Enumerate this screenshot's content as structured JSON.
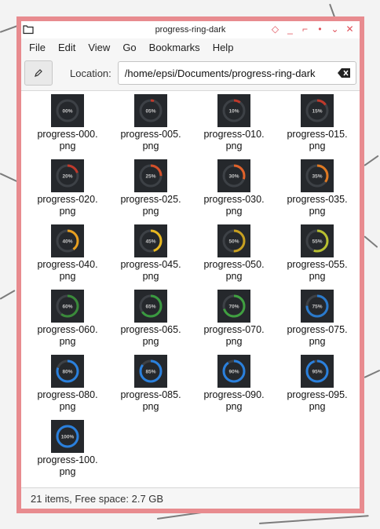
{
  "window": {
    "title": "progress-ring-dark"
  },
  "menu": [
    "File",
    "Edit",
    "View",
    "Go",
    "Bookmarks",
    "Help"
  ],
  "location": {
    "label": "Location:",
    "path": "/home/epsi/Documents/progress-ring-dark"
  },
  "files": [
    {
      "name": "progress-000.png",
      "line1": "progress-000.",
      "line2": "png",
      "percent": 0,
      "label": "00%",
      "color": "#666666"
    },
    {
      "name": "progress-005.png",
      "line1": "progress-005.",
      "line2": "png",
      "percent": 5,
      "label": "05%",
      "color": "#c0392b"
    },
    {
      "name": "progress-010.png",
      "line1": "progress-010.",
      "line2": "png",
      "percent": 10,
      "label": "10%",
      "color": "#c0392b"
    },
    {
      "name": "progress-015.png",
      "line1": "progress-015.",
      "line2": "png",
      "percent": 15,
      "label": "15%",
      "color": "#c0392b"
    },
    {
      "name": "progress-020.png",
      "line1": "progress-020.",
      "line2": "png",
      "percent": 20,
      "label": "20%",
      "color": "#c0392b"
    },
    {
      "name": "progress-025.png",
      "line1": "progress-025.",
      "line2": "png",
      "percent": 25,
      "label": "25%",
      "color": "#d4502a"
    },
    {
      "name": "progress-030.png",
      "line1": "progress-030.",
      "line2": "png",
      "percent": 30,
      "label": "30%",
      "color": "#e0622a"
    },
    {
      "name": "progress-035.png",
      "line1": "progress-035.",
      "line2": "png",
      "percent": 35,
      "label": "35%",
      "color": "#e07a22"
    },
    {
      "name": "progress-040.png",
      "line1": "progress-040.",
      "line2": "png",
      "percent": 40,
      "label": "40%",
      "color": "#e8a020"
    },
    {
      "name": "progress-045.png",
      "line1": "progress-045.",
      "line2": "png",
      "percent": 45,
      "label": "45%",
      "color": "#e8b820"
    },
    {
      "name": "progress-050.png",
      "line1": "progress-050.",
      "line2": "png",
      "percent": 50,
      "label": "50%",
      "color": "#c8a020"
    },
    {
      "name": "progress-055.png",
      "line1": "progress-055.",
      "line2": "png",
      "percent": 55,
      "label": "55%",
      "color": "#b8c030"
    },
    {
      "name": "progress-060.png",
      "line1": "progress-060.",
      "line2": "png",
      "percent": 60,
      "label": "60%",
      "color": "#3a8a3a"
    },
    {
      "name": "progress-065.png",
      "line1": "progress-065.",
      "line2": "png",
      "percent": 65,
      "label": "65%",
      "color": "#3a9a40"
    },
    {
      "name": "progress-070.png",
      "line1": "progress-070.",
      "line2": "png",
      "percent": 70,
      "label": "70%",
      "color": "#40a040"
    },
    {
      "name": "progress-075.png",
      "line1": "progress-075.",
      "line2": "png",
      "percent": 75,
      "label": "75%",
      "color": "#2a7acc"
    },
    {
      "name": "progress-080.png",
      "line1": "progress-080.",
      "line2": "png",
      "percent": 80,
      "label": "80%",
      "color": "#2a80dd"
    },
    {
      "name": "progress-085.png",
      "line1": "progress-085.",
      "line2": "png",
      "percent": 85,
      "label": "85%",
      "color": "#2a80dd"
    },
    {
      "name": "progress-090.png",
      "line1": "progress-090.",
      "line2": "png",
      "percent": 90,
      "label": "90%",
      "color": "#2a80dd"
    },
    {
      "name": "progress-095.png",
      "line1": "progress-095.",
      "line2": "png",
      "percent": 95,
      "label": "95%",
      "color": "#2a80dd"
    },
    {
      "name": "progress-100.png",
      "line1": "progress-100.",
      "line2": "png",
      "percent": 100,
      "label": "100%",
      "color": "#2a80dd"
    }
  ],
  "status": {
    "text": "21 items, Free space: 2.7 GB"
  },
  "colors": {
    "frame": "#e88b8f",
    "window_button": "#e0505a"
  }
}
